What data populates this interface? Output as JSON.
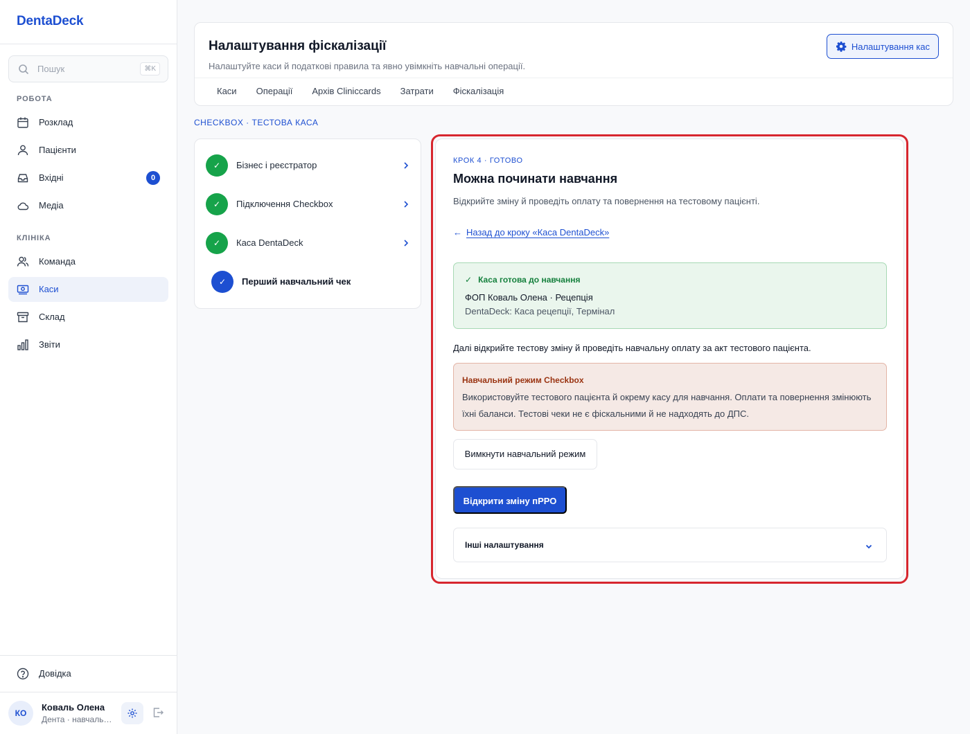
{
  "app": {
    "brand": "DentaDeck",
    "accent": "#1d4fd1",
    "search": {
      "placeholder": "Пошук",
      "shortcut": "⌘K"
    },
    "sections": {
      "work": "РОБОТА",
      "clinic": "КЛІНІКА"
    },
    "nav_work": [
      {
        "label": "Розклад",
        "icon": "calendar-icon"
      },
      {
        "label": "Пацієнти",
        "icon": "user-icon"
      },
      {
        "label": "Вхідні",
        "icon": "inbox-icon",
        "badge": "0"
      },
      {
        "label": "Медіа",
        "icon": "cloud-icon"
      }
    ],
    "nav_clinic": [
      {
        "label": "Команда",
        "icon": "team-icon"
      },
      {
        "label": "Каси",
        "icon": "cash-icon",
        "active": true
      },
      {
        "label": "Склад",
        "icon": "archive-icon"
      },
      {
        "label": "Звіти",
        "icon": "chart-icon"
      }
    ],
    "help": "Довідка",
    "user": {
      "initials": "КО",
      "name": "Коваль Олена",
      "subtitle": "Дента · навчальний режим"
    }
  },
  "header": {
    "title": "Налаштування фіскалізації",
    "subtitle": "Налаштуйте каси й податкові правила та явно увімкніть навчальні операції.",
    "settings_button": "Налаштування кас",
    "tabs": [
      "Каси",
      "Операції",
      "Архів Cliniccards",
      "Затрати",
      "Фіскалізація"
    ]
  },
  "breadcrumb": "CHECKBOX · ТЕСТОВА КАСА",
  "steps": [
    {
      "label": "Бізнес і реєстратор",
      "status": "done",
      "mark": "✓"
    },
    {
      "label": "Підключення Checkbox",
      "status": "done",
      "mark": "✓"
    },
    {
      "label": "Каса DentaDeck",
      "status": "done",
      "mark": "✓"
    },
    {
      "label": "Перший навчальний чек",
      "status": "current",
      "mark": "✓"
    }
  ],
  "panel": {
    "step_label": "КРОК 4 · ГОТОВО",
    "title": "Можна починати навчання",
    "description": "Відкрийте зміну й проведіть оплату та повернення на тестовому пацієнті.",
    "back_arrow": "←",
    "back_link": "Назад до кроку «Каса DentaDeck»",
    "ready": {
      "check": "✓",
      "title": "Каса готова до навчання",
      "line1": "ФОП Коваль Олена · Рецепція",
      "line2": "DentaDeck: Каса рецепції, Термінал"
    },
    "next_text": "Далі відкрийте тестову зміну й проведіть навчальну оплату за акт тестового пацієнта.",
    "warning": {
      "title": "Навчальний режим Checkbox",
      "body": "Використовуйте тестового пацієнта й окрему касу для навчання. Оплати та повернення змінюють їхні баланси. Тестові чеки не є фіскальними й не надходять до ДПС."
    },
    "disable_button": "Вимкнути навчальний режим",
    "open_shift_button": "Відкрити зміну пРРО",
    "other_settings": "Інші налаштування"
  }
}
